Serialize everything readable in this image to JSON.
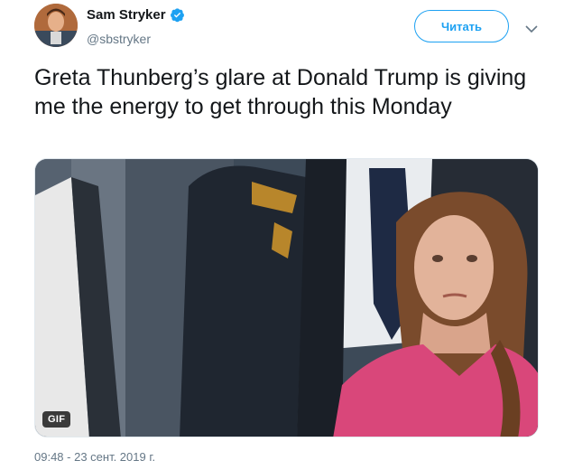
{
  "author": {
    "display_name": "Sam Stryker",
    "handle": "@sbstryker",
    "verified": true
  },
  "follow_button": {
    "label": "Читать"
  },
  "tweet": {
    "text": "Greta Thunberg’s glare at Donald Trump is giving me the energy to get through this Monday",
    "timestamp": "09:48 - 23 сент. 2019 г."
  },
  "media": {
    "badge": "GIF"
  },
  "colors": {
    "accent": "#1da1f2",
    "muted": "#657786",
    "text": "#14171a"
  },
  "icons": {
    "verified": "verified-badge-icon",
    "menu": "chevron-down-icon"
  }
}
